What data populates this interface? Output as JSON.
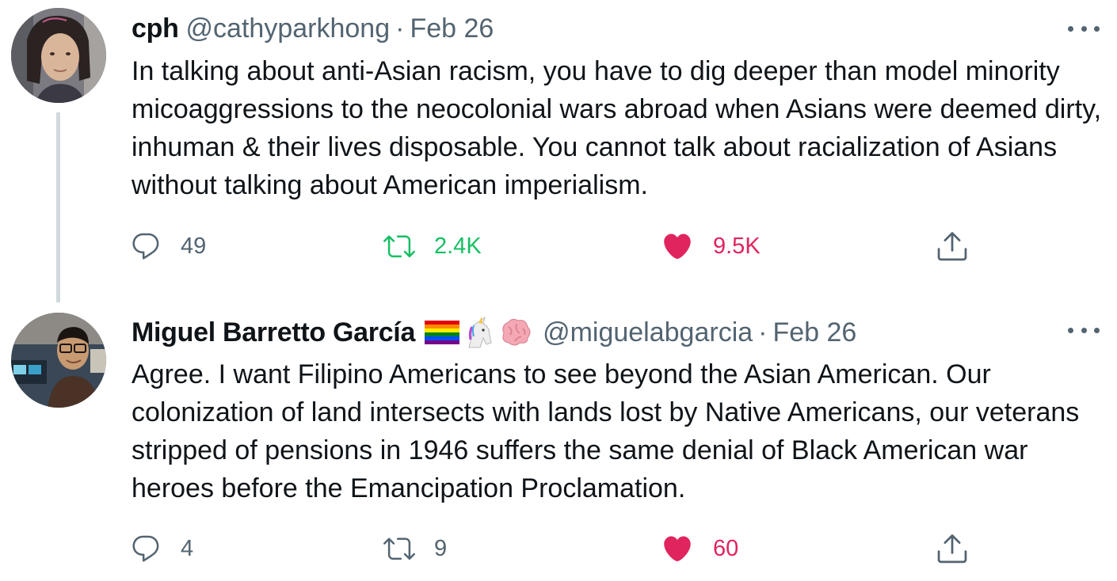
{
  "tweets": [
    {
      "display_name": "cph",
      "handle": "@cathyparkhong",
      "separator": "·",
      "date": "Feb 26",
      "emojis": [],
      "text": "In talking about anti-Asian racism, you have to dig deeper than model minority micoaggressions to the neocolonial wars abroad when Asians were deemed dirty, inhuman & their lives disposable. You cannot talk about racialization of Asians without talking about American imperialism.",
      "replies": "49",
      "retweets": "2.4K",
      "likes": "9.5K",
      "retweeted": true,
      "liked": true
    },
    {
      "display_name": "Miguel Barretto García",
      "handle": "@miguelabgarcia",
      "separator": "·",
      "date": "Feb 26",
      "emojis": [
        "rainbow-flag-icon",
        "unicorn-icon",
        "brain-icon"
      ],
      "text": "Agree. I want Filipino Americans to see beyond the Asian American. Our colonization of land intersects with lands lost by Native Americans, our veterans stripped of pensions in 1946 suffers the same denial of Black American war heroes before the Emancipation Proclamation.",
      "replies": "4",
      "retweets": "9",
      "likes": "60",
      "retweeted": false,
      "liked": true
    }
  ],
  "colors": {
    "text": "#0f1419",
    "secondary": "#536471",
    "retweet_active": "#17bf63",
    "like_active": "#e0245e",
    "thread_line": "#cfd9de"
  }
}
